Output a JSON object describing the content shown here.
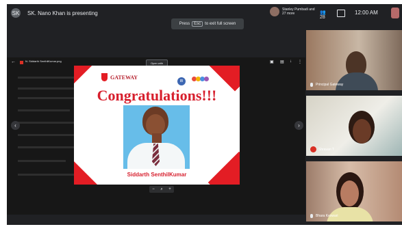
{
  "presenter": {
    "initials": "SK",
    "label": "SK. Nano Khan is presenting"
  },
  "participants_summary": "Stanley Pumbadi and 27 more",
  "header": {
    "people_count": "28",
    "time": "12:00 AM"
  },
  "fullscreen_hint": {
    "prefix": "Press",
    "key": "Esc",
    "suffix": "to exit full screen"
  },
  "viewer": {
    "filename": "N. Siddarth SenthilKumar.png",
    "open_with": "Open with"
  },
  "slide": {
    "school": "GATEWAY",
    "ib_label": "IB",
    "heading": "Congratulations!!!",
    "student_name": "Siddarth SenthilKumar"
  },
  "tiles": [
    {
      "name": "Principal Gateway"
    },
    {
      "name": "Shravan T"
    },
    {
      "name": "Bhara Keswari"
    }
  ],
  "colors": {
    "meet_dark": "#202124",
    "slide_red": "#e31d24",
    "photo_blue": "#67bde9"
  }
}
